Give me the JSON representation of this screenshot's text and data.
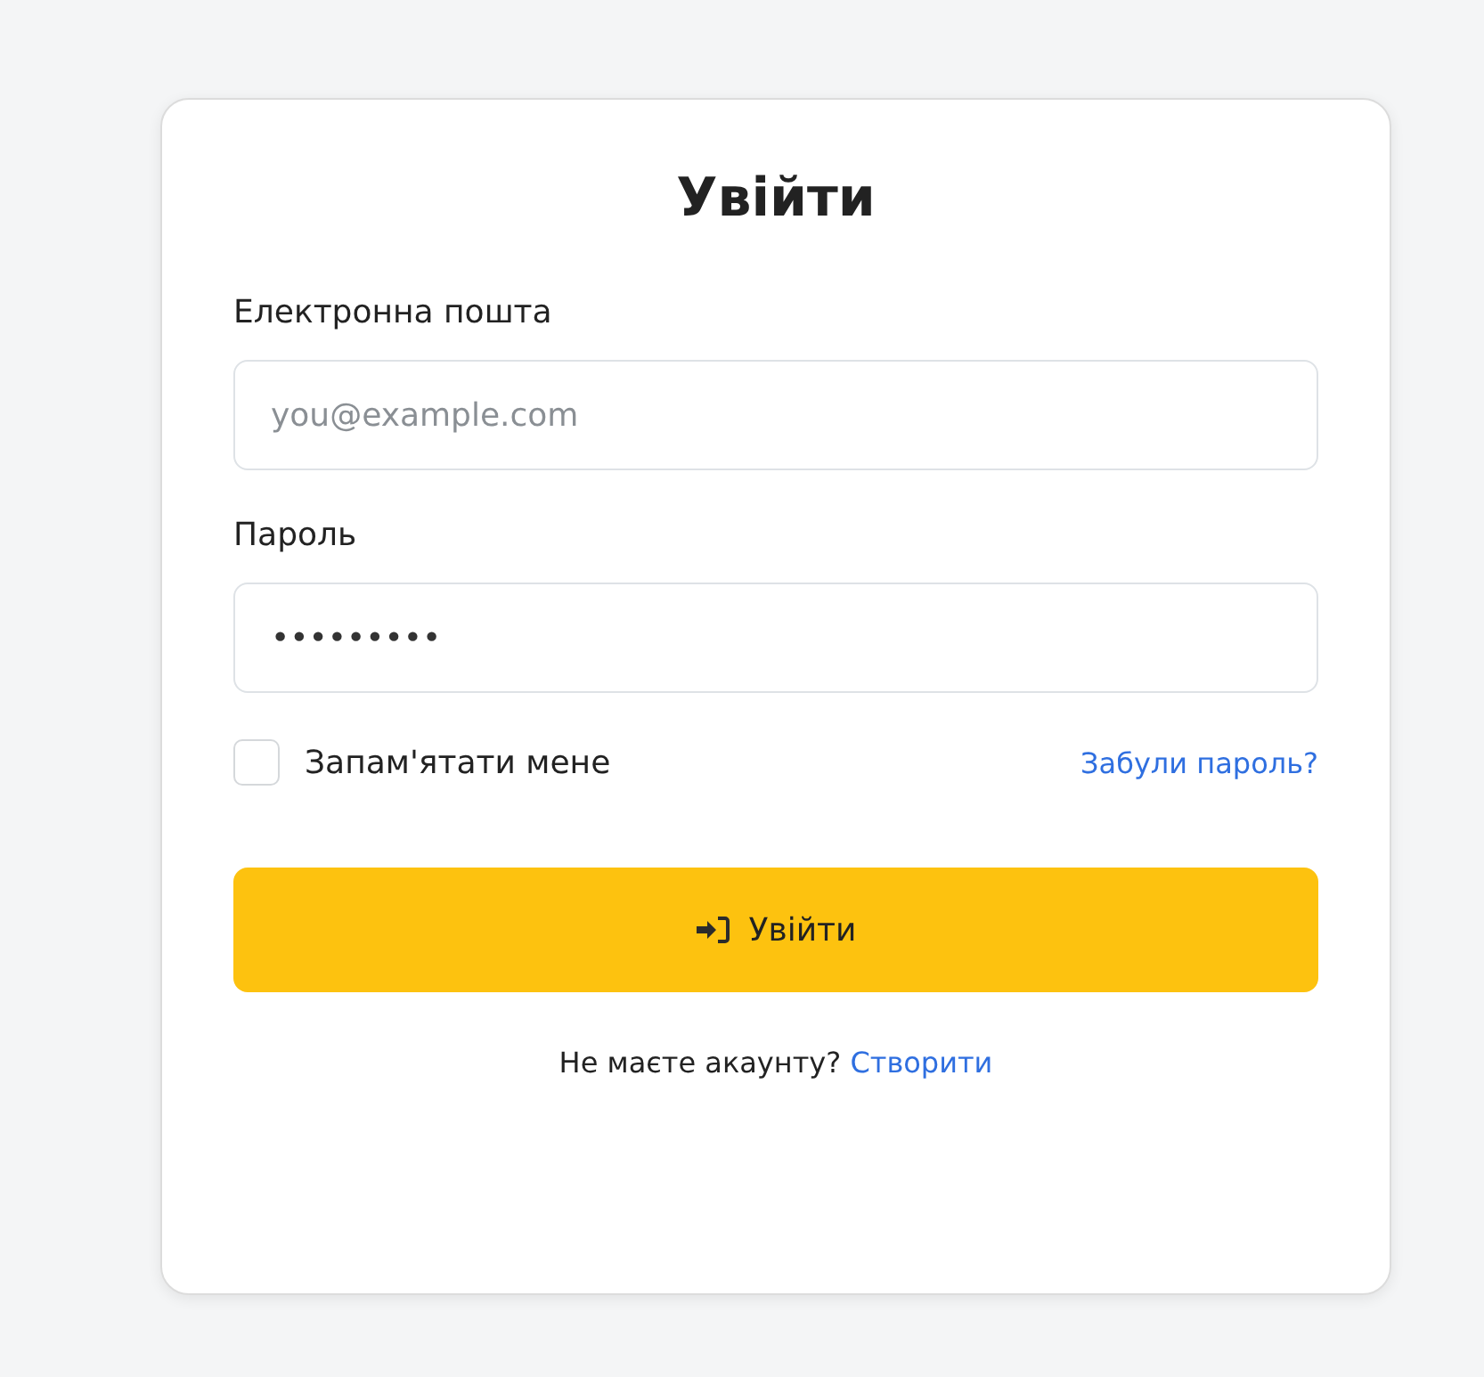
{
  "title": "Увійти",
  "fields": [
    {
      "label": "Електронна пошта",
      "placeholder": "you@example.com"
    },
    {
      "label": "Пароль",
      "value": "•••••••••"
    }
  ],
  "remember": {
    "label": "Запам'ятати мене",
    "checked": false
  },
  "forgot_link": "Забули пароль?",
  "submit_button": "Увійти",
  "footer": {
    "text": "Не маєте акаунту?",
    "link": "Створити"
  }
}
